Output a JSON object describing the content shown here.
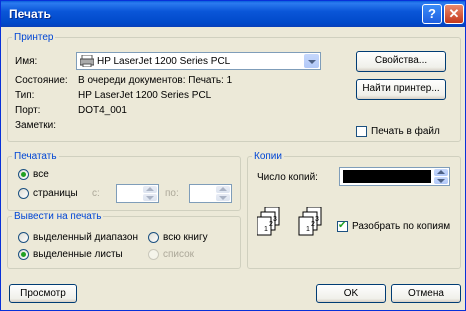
{
  "window": {
    "title": "Печать",
    "help_symbol": "?",
    "close_symbol": "✕"
  },
  "printer": {
    "group": "Принтер",
    "name_label": "Имя:",
    "name_value": "HP LaserJet 1200 Series PCL",
    "status_label": "Состояние:",
    "status_value": "В очереди документов: Печать: 1",
    "type_label": "Тип:",
    "type_value": "HP LaserJet 1200 Series PCL",
    "port_label": "Порт:",
    "port_value": "DOT4_001",
    "notes_label": "Заметки:",
    "properties_button": "Свойства...",
    "find_button": "Найти принтер...",
    "print_to_file": "Печать в файл",
    "print_to_file_checked": false
  },
  "range": {
    "group": "Печатать",
    "all": "все",
    "pages": "страницы",
    "from": "с:",
    "to": "по:"
  },
  "output": {
    "group": "Вывести на печать",
    "selection": "выделенный диапазон",
    "entire_book": "всю книгу",
    "active_sheets": "выделенные листы",
    "list": "список"
  },
  "copies": {
    "group": "Копии",
    "count_label": "Число копий:",
    "collate": "Разобрать по копиям",
    "collate_checked": true
  },
  "buttons": {
    "preview": "Просмотр",
    "ok": "OK",
    "cancel": "Отмена"
  }
}
